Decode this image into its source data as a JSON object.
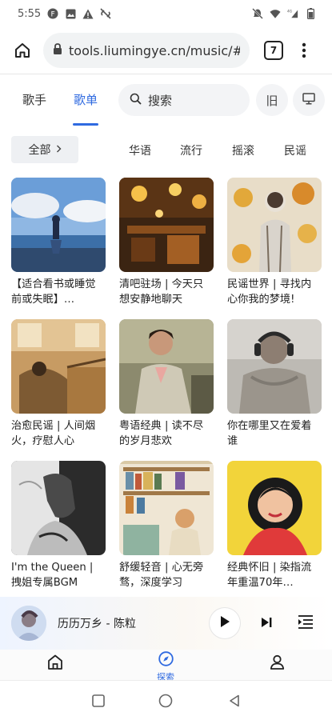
{
  "status_bar": {
    "time": "5:55",
    "icons": [
      "f-app-icon",
      "image-icon",
      "warning-icon",
      "no-link-icon"
    ],
    "right_icons": [
      "mute-icon",
      "wifi-icon",
      "signal-icon",
      "battery-icon"
    ]
  },
  "browser": {
    "url": "tools.liumingye.cn/music/#/e",
    "tab_count": "7"
  },
  "app_nav": {
    "tabs": [
      {
        "label": "歌手",
        "active": false
      },
      {
        "label": "歌单",
        "active": true
      }
    ],
    "search_placeholder": "搜索",
    "old_button": "旧"
  },
  "filters": {
    "all_label": "全部",
    "items": [
      "华语",
      "流行",
      "摇滚",
      "民谣"
    ]
  },
  "playlists": [
    {
      "title": "【适合看书或睡觉前或失眠】…"
    },
    {
      "title": "清吧驻场 | 今天只想安静地聊天"
    },
    {
      "title": "民谣世界 | 寻找内心你我的梦境!"
    },
    {
      "title": "治愈民谣 | 人间烟火，疗慰人心"
    },
    {
      "title": "粤语经典 | 读不尽的岁月悲欢"
    },
    {
      "title": "你在哪里又在爱着谁"
    },
    {
      "title": "I'm the Queen | 拽姐专属BGM"
    },
    {
      "title": "舒缓轻音 | 心无旁骛，深度学习"
    },
    {
      "title": "经典怀旧 | 染指流年重温70年…"
    }
  ],
  "player": {
    "song": "历历万乡 - 陈粒"
  },
  "bottom_nav": {
    "explore_label": "探索"
  },
  "colors": {
    "accent": "#2f6ae0"
  }
}
